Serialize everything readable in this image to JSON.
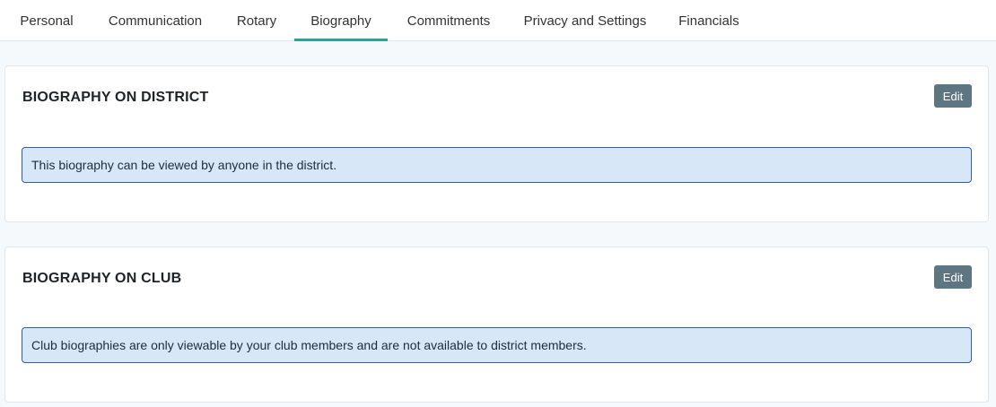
{
  "tabs": [
    {
      "label": "Personal",
      "active": false
    },
    {
      "label": "Communication",
      "active": false
    },
    {
      "label": "Rotary",
      "active": false
    },
    {
      "label": "Biography",
      "active": true
    },
    {
      "label": "Commitments",
      "active": false
    },
    {
      "label": "Privacy and Settings",
      "active": false
    },
    {
      "label": "Financials",
      "active": false
    }
  ],
  "district_section": {
    "title": "BIOGRAPHY ON DISTRICT",
    "edit_label": "Edit",
    "info_text": "This biography can be viewed by anyone in the district."
  },
  "club_section": {
    "title": "BIOGRAPHY ON CLUB",
    "edit_label": "Edit",
    "info_text": "Club biographies are only viewable by your club members and are not available to district members."
  },
  "colors": {
    "active_tab_underline": "#27a59b",
    "edit_button": "#5e7682",
    "info_background": "#d8e7f8",
    "info_border": "#2c5fa8"
  }
}
